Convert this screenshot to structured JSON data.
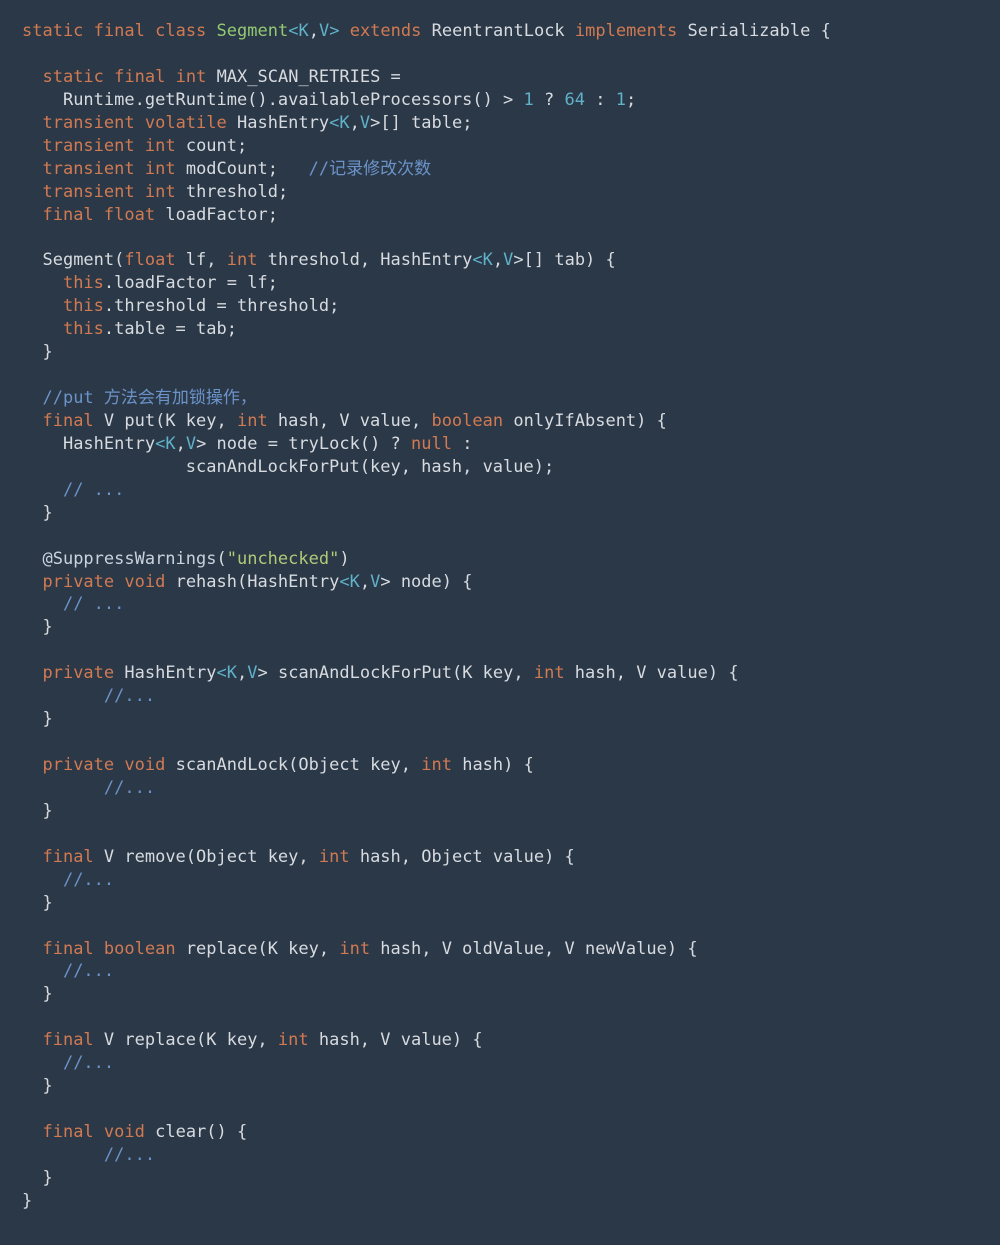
{
  "code": {
    "line1": {
      "t1": "static",
      "t2": "final",
      "t3": "class",
      "t4": "Segment",
      "t5": "<",
      "t6": "K",
      "t7": ",",
      "t8": "V",
      "t9": ">",
      "t10": "extends",
      "t11": "ReentrantLock",
      "t12": "implements",
      "t13": "Serializable {"
    },
    "line3": {
      "t1": "static",
      "t2": "final",
      "t3": "int",
      "t4": "MAX_SCAN_RETRIES ="
    },
    "line4": {
      "t1": "Runtime.getRuntime().availableProcessors() > ",
      "t2": "1",
      "t3": " ? ",
      "t4": "64",
      "t5": " : ",
      "t6": "1",
      "t7": ";"
    },
    "line5": {
      "t1": "transient",
      "t2": "volatile",
      "t3": "HashEntry",
      "t4": "<",
      "t5": "K",
      "t6": ",",
      "t7": "V",
      "t8": ">[] table;"
    },
    "line6": {
      "t1": "transient",
      "t2": "int",
      "t3": "count;"
    },
    "line7": {
      "t1": "transient",
      "t2": "int",
      "t3": "modCount;",
      "t4": "//记录修改次数"
    },
    "line8": {
      "t1": "transient",
      "t2": "int",
      "t3": "threshold;"
    },
    "line9": {
      "t1": "final",
      "t2": "float",
      "t3": "loadFactor;"
    },
    "line11": {
      "t1": "Segment(",
      "t2": "float",
      "t3": " lf, ",
      "t4": "int",
      "t5": " threshold, HashEntry",
      "t6": "<",
      "t7": "K",
      "t8": ",",
      "t9": "V",
      "t10": ">[] tab) {"
    },
    "line12": {
      "t1": "this",
      "t2": ".loadFactor = lf;"
    },
    "line13": {
      "t1": "this",
      "t2": ".threshold = threshold;"
    },
    "line14": {
      "t1": "this",
      "t2": ".table = tab;"
    },
    "line15": {
      "t1": "}"
    },
    "line17": {
      "t1": "//put 方法会有加锁操作，"
    },
    "line18": {
      "t1": "final",
      "t2": " V put(K key, ",
      "t3": "int",
      "t4": " hash, V value, ",
      "t5": "boolean",
      "t6": " onlyIfAbsent) {"
    },
    "line19": {
      "t1": "HashEntry",
      "t2": "<",
      "t3": "K",
      "t4": ",",
      "t5": "V",
      "t6": "> node = tryLock() ? ",
      "t7": "null",
      "t8": " :"
    },
    "line20": {
      "t1": "scanAndLockForPut(key, hash, value);"
    },
    "line21": {
      "t1": "// ..."
    },
    "line22": {
      "t1": "}"
    },
    "line24": {
      "t1": "@SuppressWarnings",
      "t2": "(",
      "t3": "\"unchecked\"",
      "t4": ")"
    },
    "line25": {
      "t1": "private",
      "t2": "void",
      "t3": " rehash(HashEntry",
      "t4": "<",
      "t5": "K",
      "t6": ",",
      "t7": "V",
      "t8": "> node) {"
    },
    "line26": {
      "t1": "// ..."
    },
    "line27": {
      "t1": "}"
    },
    "line29": {
      "t1": "private",
      "t2": " HashEntry",
      "t3": "<",
      "t4": "K",
      "t5": ",",
      "t6": "V",
      "t7": "> scanAndLockForPut(K key, ",
      "t8": "int",
      "t9": " hash, V value) {"
    },
    "line30": {
      "t1": "//..."
    },
    "line31": {
      "t1": "}"
    },
    "line33": {
      "t1": "private",
      "t2": "void",
      "t3": " scanAndLock(",
      "t4": "Object",
      "t5": " key, ",
      "t6": "int",
      "t7": " hash) {"
    },
    "line34": {
      "t1": "//..."
    },
    "line35": {
      "t1": "}"
    },
    "line37": {
      "t1": "final",
      "t2": " V remove(",
      "t3": "Object",
      "t4": " key, ",
      "t5": "int",
      "t6": " hash, ",
      "t7": "Object",
      "t8": " value) {"
    },
    "line38": {
      "t1": "//..."
    },
    "line39": {
      "t1": "}"
    },
    "line41": {
      "t1": "final",
      "t2": "boolean",
      "t3": " replace(K key, ",
      "t4": "int",
      "t5": " hash, V oldValue, V newValue) {"
    },
    "line42": {
      "t1": "//..."
    },
    "line43": {
      "t1": "}"
    },
    "line45": {
      "t1": "final",
      "t2": " V replace(K key, ",
      "t3": "int",
      "t4": " hash, V value) {"
    },
    "line46": {
      "t1": "//..."
    },
    "line47": {
      "t1": "}"
    },
    "line49": {
      "t1": "final",
      "t2": "void",
      "t3": " clear() {"
    },
    "line50": {
      "t1": "//..."
    },
    "line51": {
      "t1": "}"
    },
    "line52": {
      "t1": "}"
    }
  }
}
